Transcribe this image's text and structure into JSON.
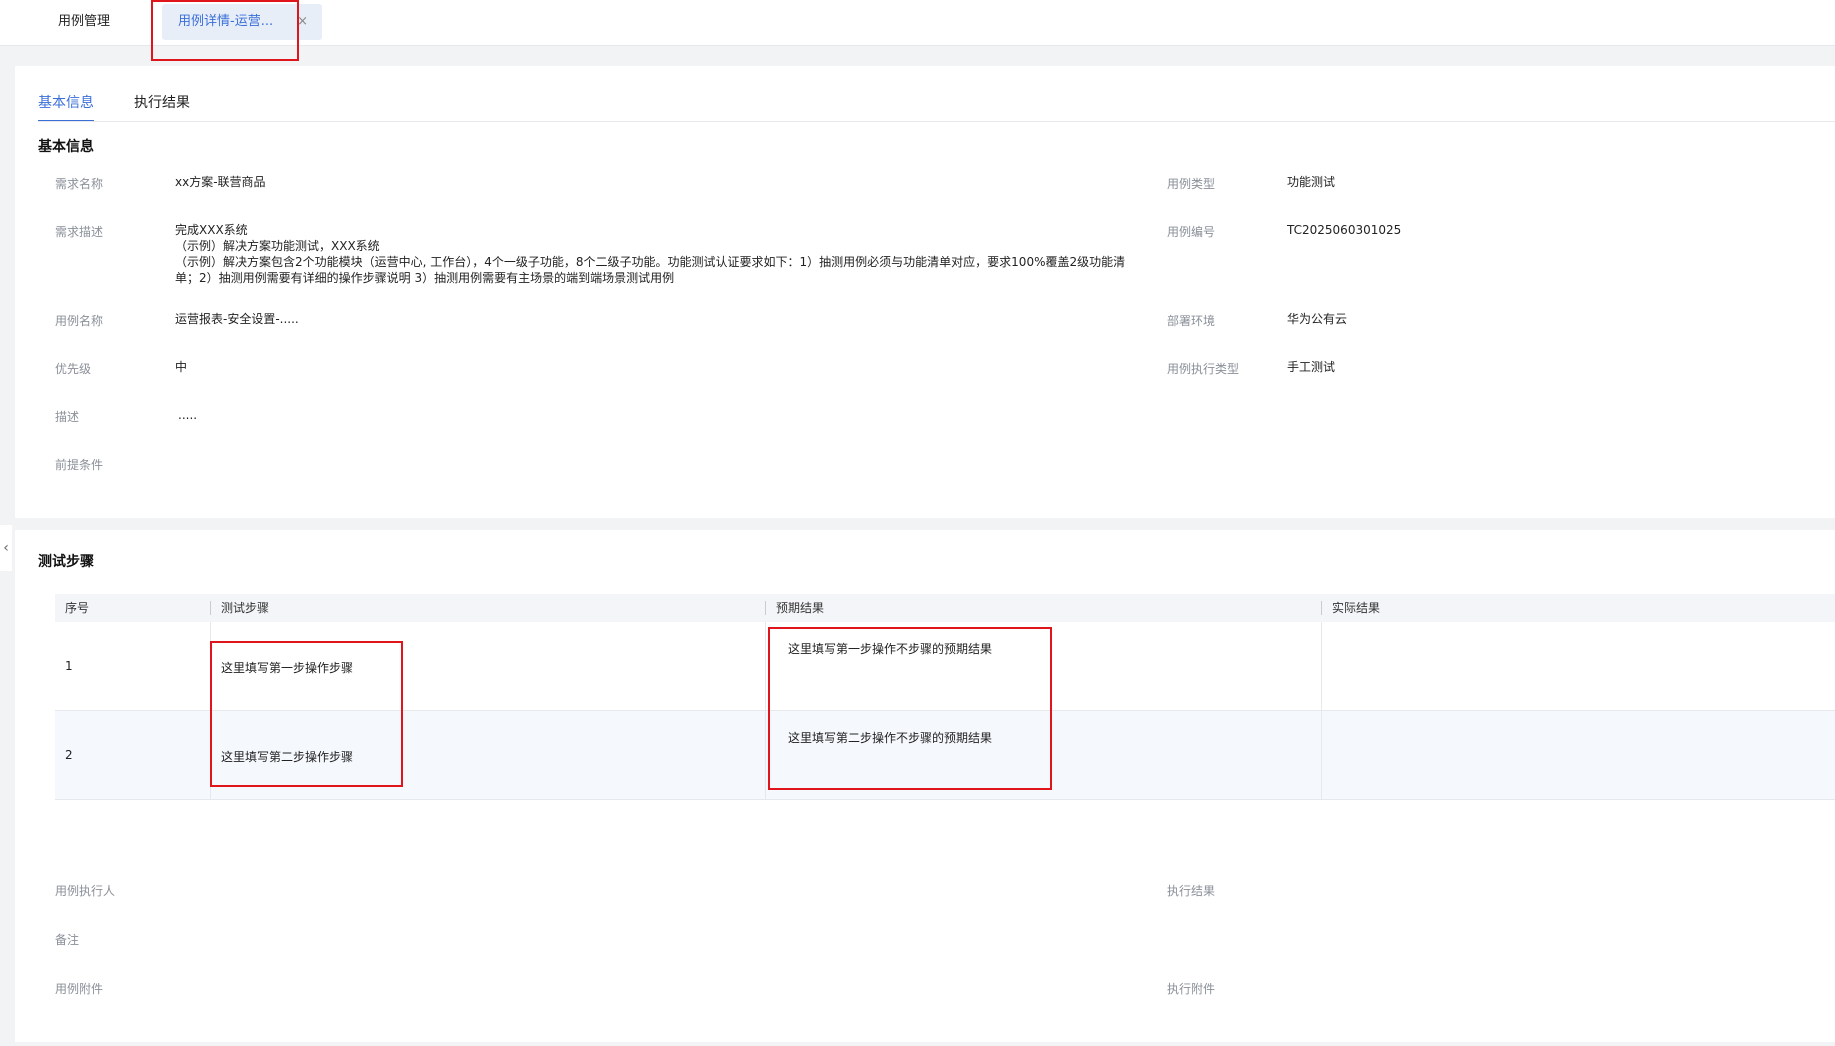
{
  "top_tabs": [
    {
      "label": "用例管理"
    },
    {
      "label": "用例详情-运营...",
      "close": "×"
    }
  ],
  "sub_tabs": [
    {
      "label": "基本信息",
      "active": true
    },
    {
      "label": "执行结果",
      "active": false
    }
  ],
  "basic_info": {
    "title": "基本信息",
    "fields_left": [
      {
        "label": "需求名称",
        "value": "xx方案-联营商品"
      },
      {
        "label": "需求描述",
        "value_lines": [
          "完成XXX系统",
          "（示例）解决方案功能测试，XXX系统",
          "（示例）解决方案包含2个功能模块（运营中心, 工作台），4个一级子功能，8个二级子功能。功能测试认证要求如下：1）抽测用例必须与功能清单对应，要求100%覆盖2级功能清",
          "单；2）抽测用例需要有详细的操作步骤说明 3）抽测用例需要有主场景的端到端场景测试用例"
        ]
      },
      {
        "label": "用例名称",
        "value": "运营报表-安全设置-....."
      },
      {
        "label": "优先级",
        "value": "中"
      },
      {
        "label": "描述",
        "value": "....."
      },
      {
        "label": "前提条件",
        "value": ""
      }
    ],
    "fields_right": [
      {
        "label": "用例类型",
        "value": "功能测试"
      },
      {
        "label": "用例编号",
        "value": "TC2025060301025"
      },
      {
        "label": "部署环境",
        "value": "华为公有云"
      },
      {
        "label": "用例执行类型",
        "value": "手工测试"
      }
    ]
  },
  "test_steps": {
    "title": "测试步骤",
    "columns": [
      "序号",
      "测试步骤",
      "预期结果",
      "实际结果"
    ],
    "rows": [
      {
        "no": "1",
        "step": "这里填写第一步操作步骤",
        "expected": "这里填写第一步操作不步骤的预期结果",
        "actual": ""
      },
      {
        "no": "2",
        "step": "这里填写第二步操作步骤",
        "expected": "这里填写第二步操作不步骤的预期结果",
        "actual": ""
      }
    ]
  },
  "execution": {
    "fields_left": [
      {
        "label": "用例执行人"
      },
      {
        "label": "备注"
      },
      {
        "label": "用例附件"
      }
    ],
    "fields_right": [
      {
        "label": "执行结果"
      },
      {
        "label": "执行附件"
      }
    ]
  },
  "colors": {
    "accent": "#3a6fd8",
    "highlight": "#e0151b"
  }
}
